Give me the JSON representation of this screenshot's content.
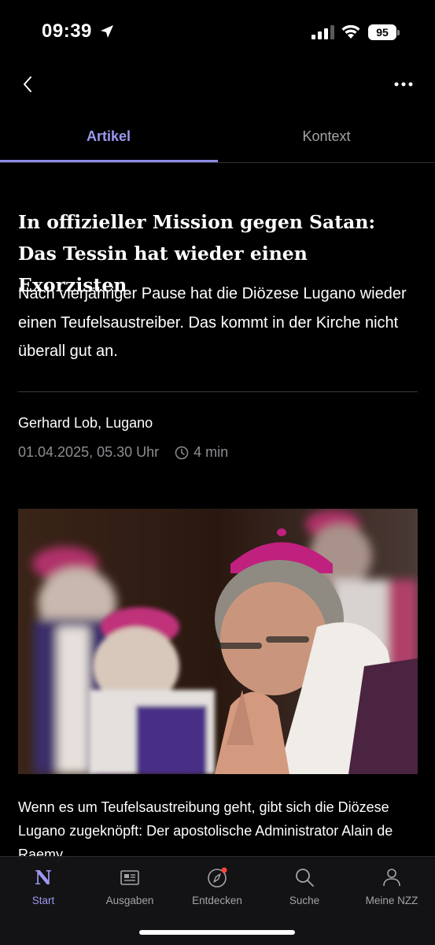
{
  "status_bar": {
    "time": "09:39",
    "battery": "95"
  },
  "nav": {
    "back_icon": "chevron-left-icon",
    "more_icon": "more-dots-icon"
  },
  "tabs": [
    {
      "label": "Artikel",
      "active": true
    },
    {
      "label": "Kontext",
      "active": false
    }
  ],
  "article": {
    "headline": "In offizieller Mission gegen Satan: Das Tessin hat wieder einen Exorzisten",
    "lead": "Nach vierjähriger Pause hat die Diözese Lugano wieder einen Teufelsaustreiber. Das kommt in der Kirche nicht überall gut an.",
    "author": "Gerhard Lob, Lugano",
    "date": "01.04.2025, 05.30 Uhr",
    "reading_time": "4 min",
    "body_start": "Wenn es um Teufelsaustreibung geht, gibt sich die Diözese Lugano zugeknöpft: Der apostolische Administrator Alain de Raemy."
  },
  "bottom_tabs": [
    {
      "label": "Start",
      "icon": "nzz-logo-icon",
      "active": true
    },
    {
      "label": "Ausgaben",
      "icon": "newspaper-icon",
      "active": false
    },
    {
      "label": "Entdecken",
      "icon": "compass-icon",
      "active": false,
      "badge": true
    },
    {
      "label": "Suche",
      "icon": "search-icon",
      "active": false
    },
    {
      "label": "Meine NZZ",
      "icon": "person-icon",
      "active": false
    }
  ],
  "colors": {
    "accent": "#9c98f0",
    "background": "#000000",
    "muted_text": "#8e8e93",
    "badge": "#ff453a"
  }
}
